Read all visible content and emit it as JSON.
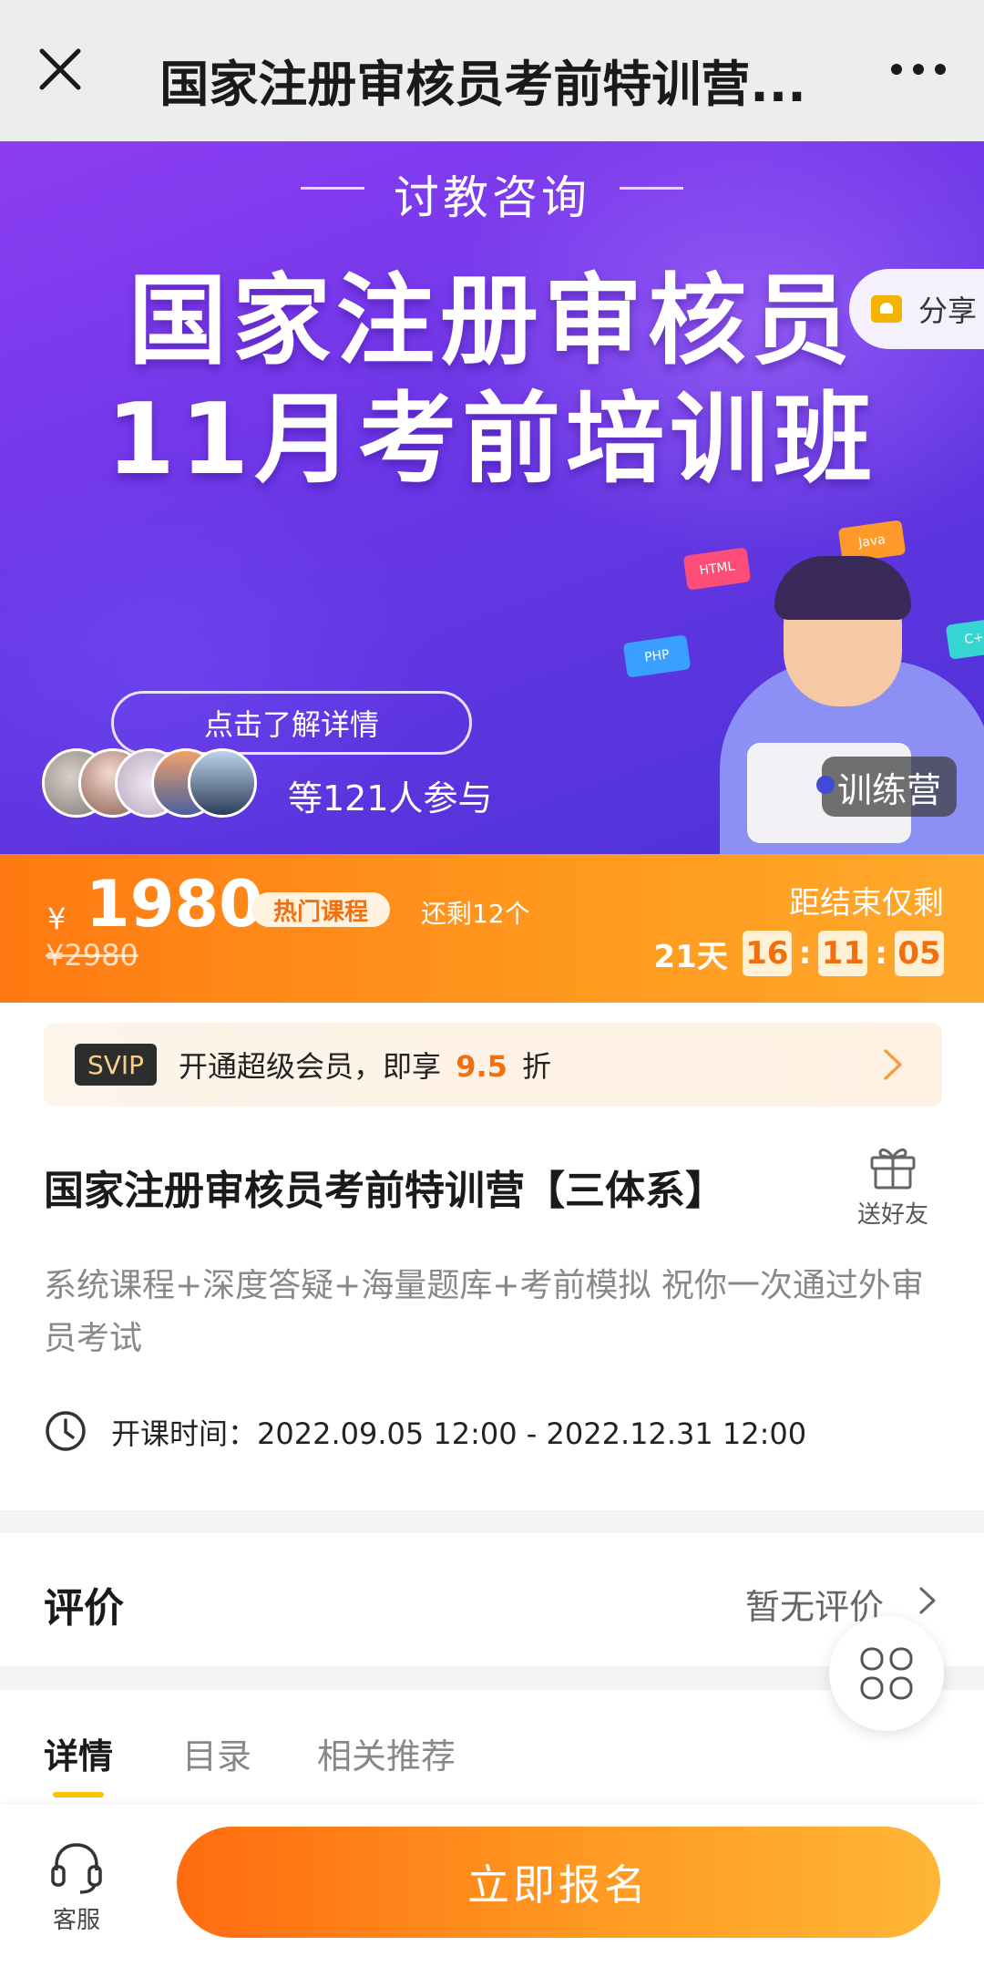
{
  "nav": {
    "title": "国家注册审核员考前特训营..."
  },
  "banner": {
    "subtitle": "讨教咨询",
    "title_line1": "国家注册审核员",
    "title_line2": "11月考前培训班",
    "share_label": "分享",
    "detail_button": "点击了解详情",
    "participants": "等121人参与",
    "camp_badge": "训练营",
    "tags": [
      "HTML",
      "Java",
      "PHP",
      "C++"
    ]
  },
  "price": {
    "currency": "¥",
    "current": "1980",
    "hot_tag": "热门课程",
    "remaining": "还剩12个",
    "original": "¥2980",
    "end_label": "距结束仅剩",
    "days": "21天",
    "hours": "16",
    "minutes": "11",
    "seconds": "05"
  },
  "svip": {
    "badge": "SVIP",
    "text_before": "开通超级会员，即享",
    "rate": "9.5",
    "text_after": "折"
  },
  "course": {
    "title": "国家注册审核员考前特训营【三体系】",
    "gift_label": "送好友",
    "description": "系统课程+深度答疑+海量题库+考前模拟 祝你一次通过外审员考试",
    "time": "开课时间：2022.09.05 12:00 - 2022.12.31 12:00"
  },
  "reviews": {
    "title": "评价",
    "empty": "暂无评价"
  },
  "tabs": [
    {
      "label": "详情",
      "active": true
    },
    {
      "label": "目录",
      "active": false
    },
    {
      "label": "相关推荐",
      "active": false
    }
  ],
  "bottom": {
    "service_label": "客服",
    "enroll_label": "立即报名"
  },
  "colors": {
    "accent": "#ff7a12",
    "underline": "#f9c400",
    "banner": "#6a37e6"
  }
}
